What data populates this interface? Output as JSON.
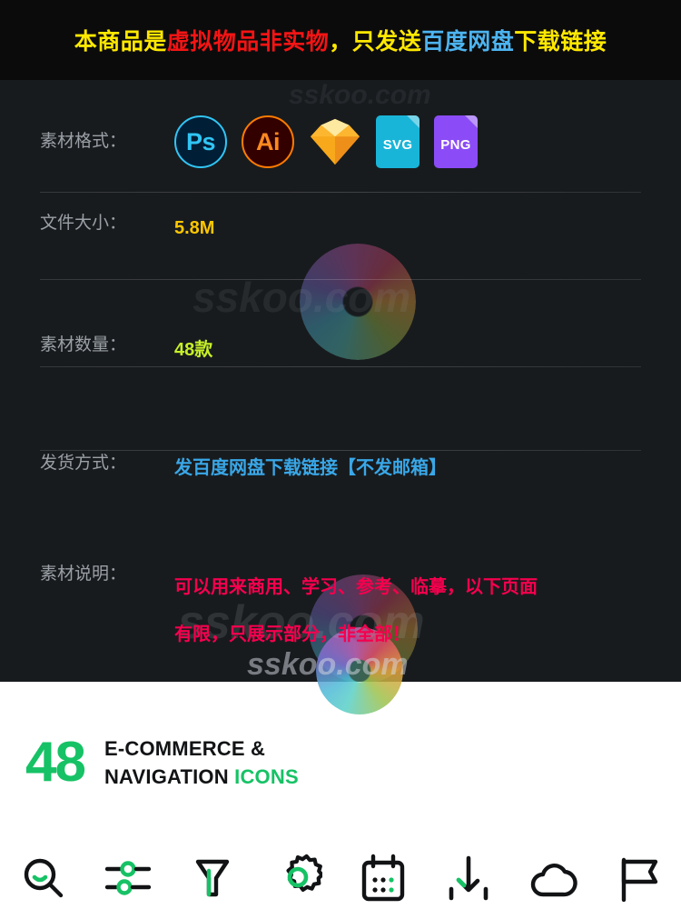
{
  "banner": {
    "segments": [
      {
        "text": "本商品是",
        "color": "#ffe800",
        "class": "c-yellow"
      },
      {
        "text": "虚拟物品非实物",
        "color": "#f41414",
        "class": "c-red"
      },
      {
        "text": "，只发送",
        "color": "#ffe800",
        "class": "c-yellow"
      },
      {
        "text": "百度网盘",
        "color": "#4db4f0",
        "class": "c-blue"
      },
      {
        "text": "下载链接",
        "color": "#ffe800",
        "class": "c-yellow"
      }
    ],
    "full_text": "本商品是虚拟物品非实物，只发送百度网盘下载链接"
  },
  "rows": {
    "format": {
      "label": "素材格式：",
      "icons": [
        {
          "name": "photoshop-icon",
          "label": "Ps"
        },
        {
          "name": "illustrator-icon",
          "label": "Ai"
        },
        {
          "name": "sketch-icon",
          "label": "Sketch"
        },
        {
          "name": "svg-file-icon",
          "label": "SVG"
        },
        {
          "name": "png-file-icon",
          "label": "PNG"
        }
      ]
    },
    "size": {
      "label": "文件大小：",
      "value": "5.8M",
      "color": "#fdc700"
    },
    "count": {
      "label": "素材数量：",
      "value": "48款",
      "color": "#c6f028"
    },
    "shipping": {
      "label": "发货方式：",
      "value": "发百度网盘下载链接【不发邮箱】",
      "color": "#39a7e8"
    },
    "description": {
      "label": "素材说明：",
      "line1": "可以用来商用、学习、参考、临摹，以下页面",
      "line2": "有限，只展示部分，非全部！",
      "color": "#f5004e"
    }
  },
  "watermarks": {
    "w1": "sskoo.com",
    "w2": "sskoo.com",
    "w3": "sskoo.com",
    "w4": "sskoo.com"
  },
  "preview": {
    "count": "48",
    "title_line1": "E-COMMERCE &",
    "title_line2_main": "NAVIGATION",
    "title_line2_accent": "ICONS",
    "accent_color": "#16c265",
    "icons": [
      {
        "name": "search-icon",
        "label": "Search"
      },
      {
        "name": "sliders-icon",
        "label": "Filters"
      },
      {
        "name": "funnel-icon",
        "label": "Funnel"
      },
      {
        "name": "settings-gear-icon",
        "label": "Settings"
      },
      {
        "name": "calendar-icon",
        "label": "Calendar"
      },
      {
        "name": "download-icon",
        "label": "Download"
      },
      {
        "name": "cloud-icon",
        "label": "Cloud"
      },
      {
        "name": "flag-icon",
        "label": "Flag"
      }
    ]
  }
}
